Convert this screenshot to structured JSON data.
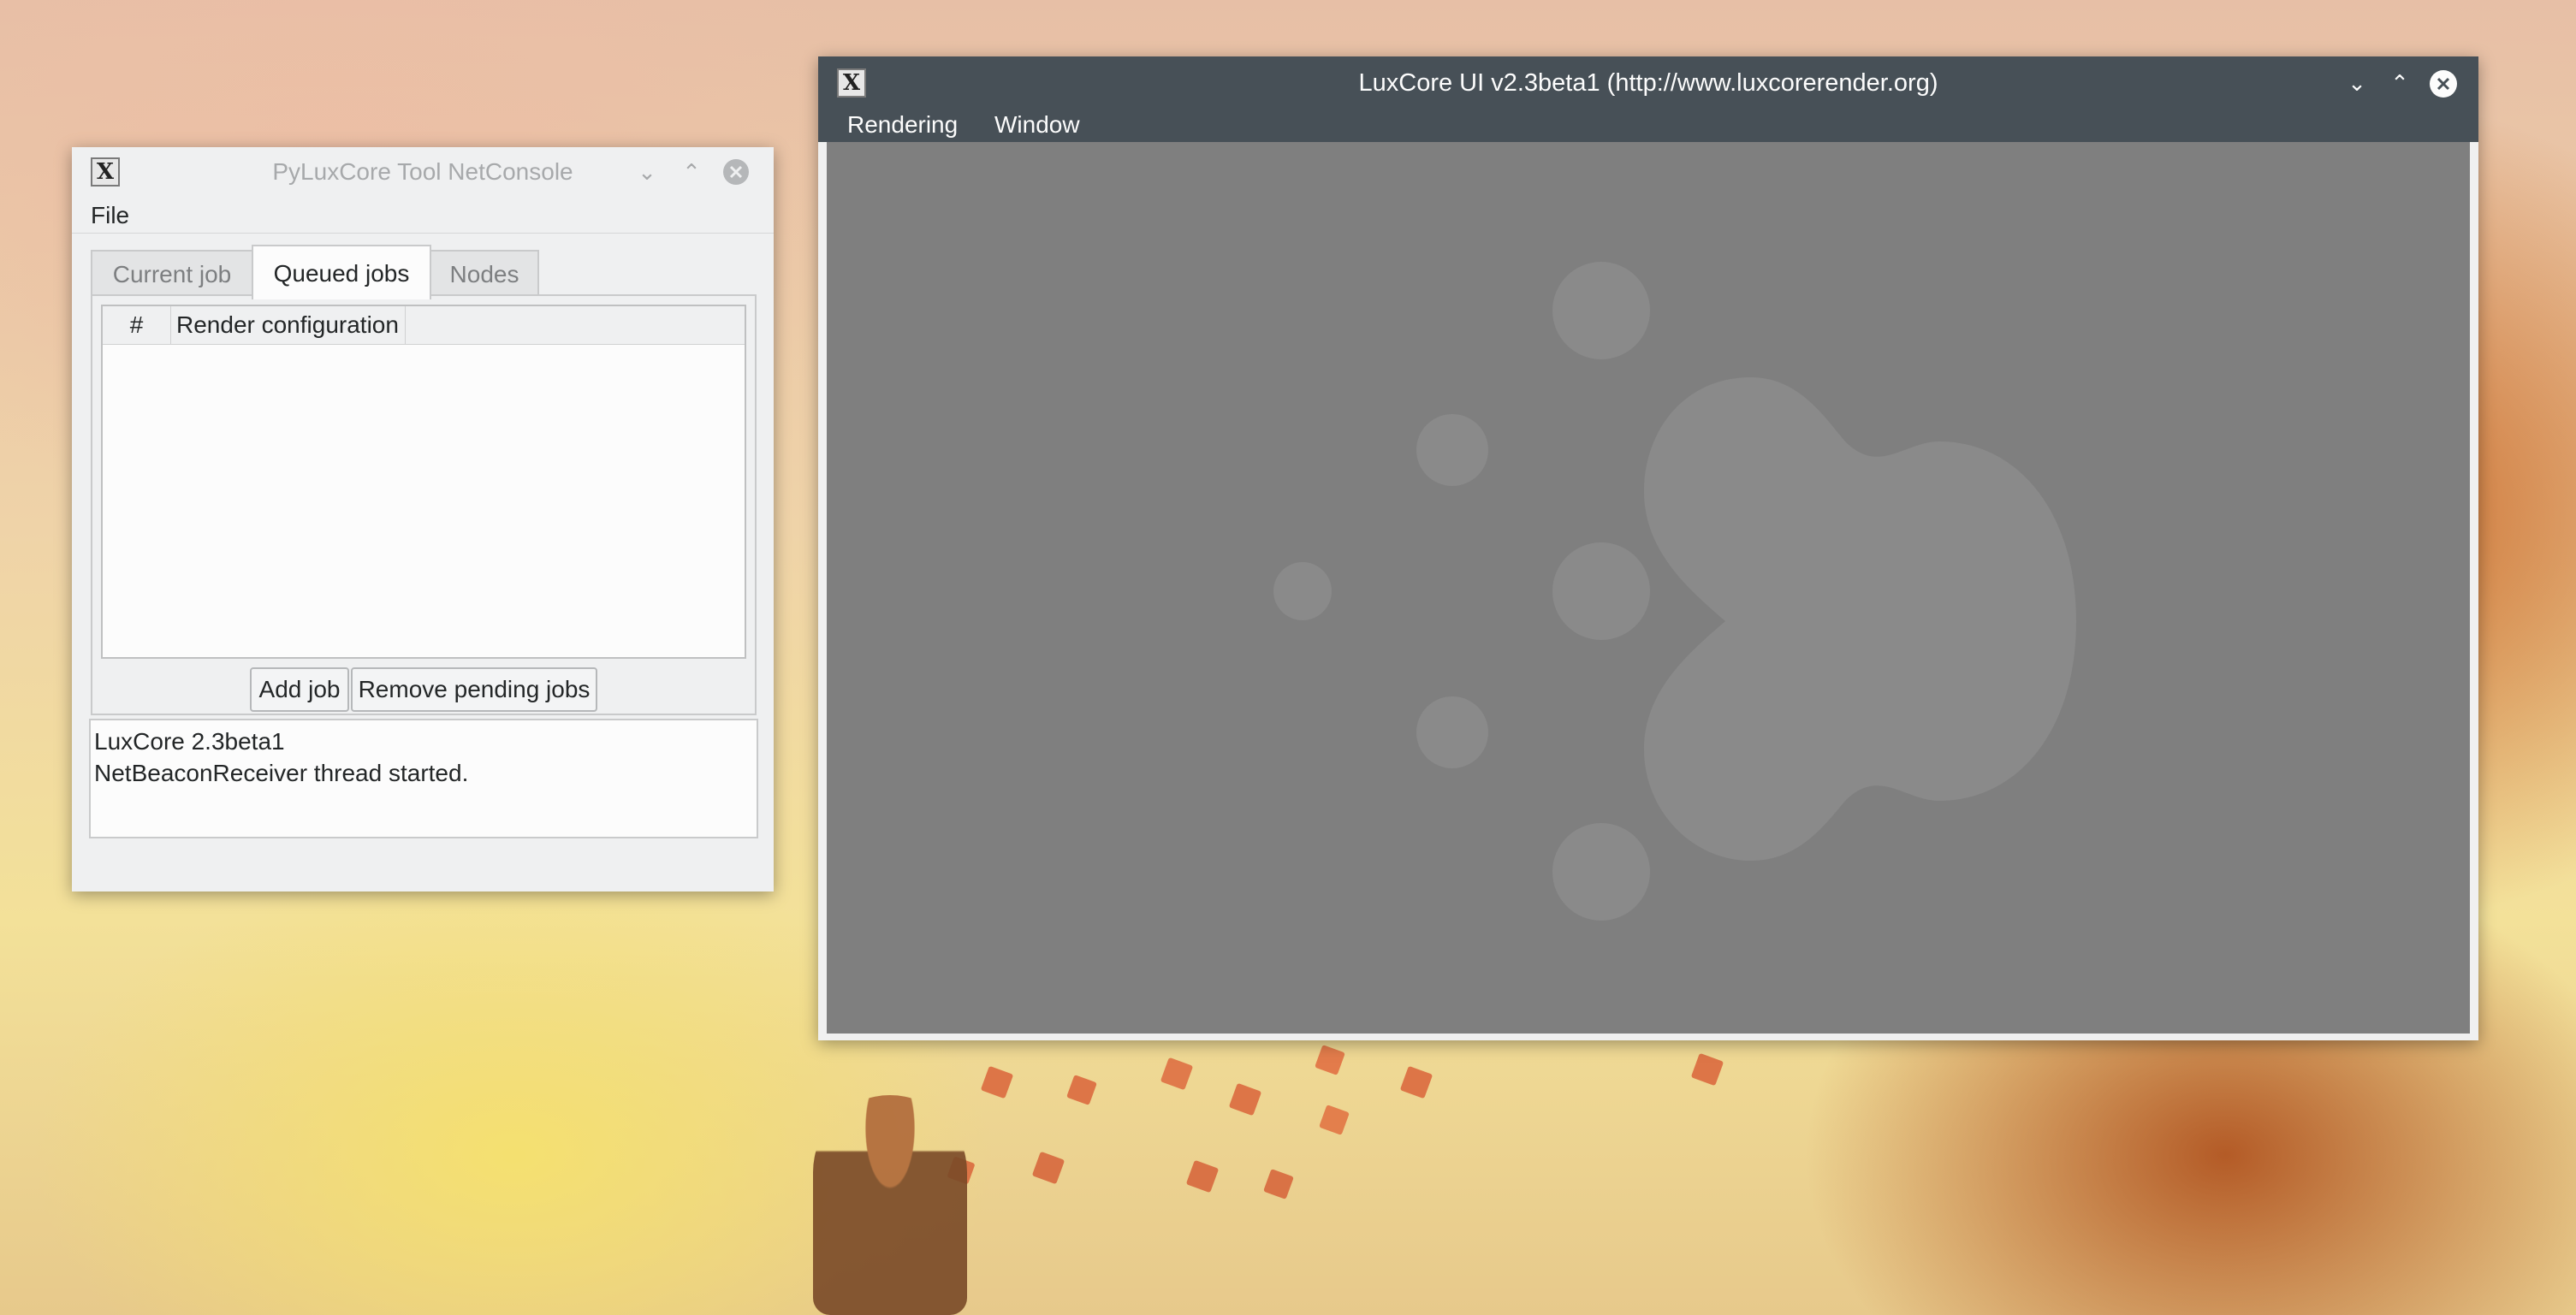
{
  "netconsole": {
    "title": "PyLuxCore Tool NetConsole",
    "menu": {
      "file": "File"
    },
    "tabs": [
      {
        "label": "Current job",
        "active": false
      },
      {
        "label": "Queued jobs",
        "active": true
      },
      {
        "label": "Nodes",
        "active": false
      }
    ],
    "table": {
      "columns": [
        "#",
        "Render configuration"
      ],
      "rows": []
    },
    "buttons": {
      "add_job": "Add job",
      "remove_pending": "Remove pending jobs"
    },
    "log": [
      "LuxCore 2.3beta1",
      "NetBeaconReceiver thread started."
    ],
    "icons": {
      "app": "luxcore-x-icon",
      "minimize": "chevron-down-icon",
      "maximize": "chevron-up-icon",
      "close": "close-circle-icon"
    }
  },
  "luxcore_ui": {
    "title": "LuxCore UI v2.3beta1 (http://www.luxcorerender.org)",
    "menu": {
      "rendering": "Rendering",
      "window": "Window"
    },
    "icons": {
      "app": "luxcore-x-icon",
      "minimize": "chevron-down-icon",
      "maximize": "chevron-up-icon",
      "close": "close-circle-icon"
    }
  },
  "colors": {
    "titlebar_dark": "#475057",
    "canvas": "#7f7f7f",
    "window_bg": "#eff0f1"
  }
}
